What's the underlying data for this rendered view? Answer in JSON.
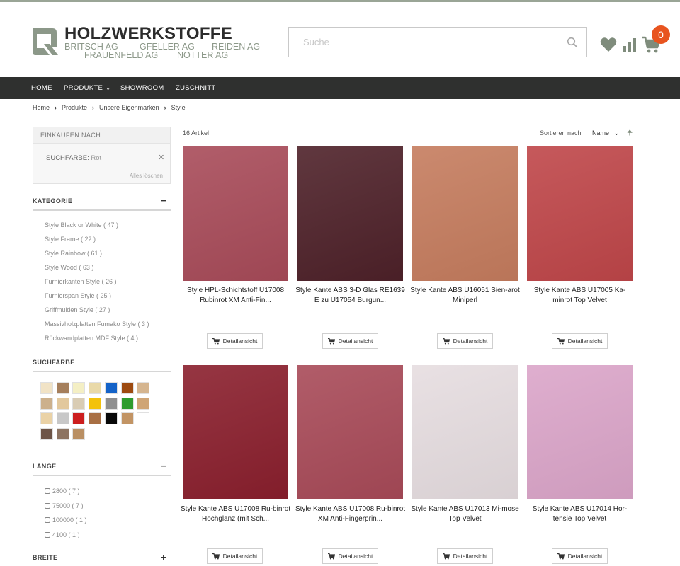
{
  "brand": {
    "title": "HOLZWERKSTOFFE",
    "sub": [
      "BRITSCH AG",
      "GFELLER AG",
      "REIDEN AG",
      "FRAUENFELD AG",
      "NOTTER AG"
    ]
  },
  "search": {
    "placeholder": "Suche"
  },
  "header_icons": [
    "search-icon",
    "heart-icon",
    "bar-chart-icon",
    "cart-icon"
  ],
  "cart": {
    "count": "0"
  },
  "colors": {
    "accent": "#e8541f",
    "nav_bg": "#2f302f",
    "brand_green": "#8c9889"
  },
  "nav": {
    "home": "HOME",
    "produkte": "PRODUKTE",
    "showroom": "SHOWROOM",
    "zuschnitt": "ZUSCHNITT"
  },
  "breadcrumb": [
    "Home",
    "Produkte",
    "Unsere Eigenmarken",
    "Style"
  ],
  "shop_by": {
    "title": "EINKAUFEN NACH",
    "filter_label": "SUCHFARBE:",
    "filter_value": "Rot",
    "clear_all": "Alles löschen"
  },
  "kategorie": {
    "title": "KATEGORIE",
    "items": [
      "Style Black or White ( 47 )",
      "Style Frame ( 22 )",
      "Style Rainbow ( 61 )",
      "Style Wood ( 63 )",
      "Furnierkanten Style ( 26 )",
      "Furnierspan Style ( 25 )",
      "Griffmulden Style ( 27 )",
      "Massivholzplatten Fumako Style ( 3 )",
      "Rückwandplatten MDF Style ( 4 )"
    ]
  },
  "suchfarbe": {
    "title": "SUCHFARBE",
    "swatches": [
      "#f1e3c6",
      "#a57f5c",
      "#f4efc4",
      "#e9d9a8",
      "#1563c8",
      "#9d4a10",
      "#d5b58f",
      "#ccb08c",
      "#e2c89d",
      "#d9ccb4",
      "#f3c20b",
      "#8f8f8f",
      "#2e9b2e",
      "#cfa576",
      "#ead2a6",
      "#c8c8c8",
      "#cc1e1e",
      "#a86f44",
      "#080808",
      "#c29464",
      "#ffffff",
      "#6d5447",
      "#8d7462",
      "#b98f63"
    ]
  },
  "laenge": {
    "title": "LÄNGE",
    "items": [
      "2800 ( 7 )",
      "75000 ( 7 )",
      "100000 ( 1 )",
      "4100 ( 1 )"
    ]
  },
  "breite": {
    "title": "BREITE"
  },
  "toolbar": {
    "count": "16 Artikel",
    "sort_label": "Sortieren nach",
    "sort_value": "Name"
  },
  "products": [
    {
      "name": "Style HPL-Schichtstoff U17008 Rubinrot XM Anti-Fin...",
      "color": "#a84b59",
      "button": "Detailansicht"
    },
    {
      "name": "Style Kante ABS 3-D Glas RE1639 E zu U17054 Burgun...",
      "color": "#4e2129",
      "button": "Detailansicht"
    },
    {
      "name": "Style Kante ABS U16051 Sien-arot Miniperl",
      "color": "#c57c5e",
      "button": "Detailansicht"
    },
    {
      "name": "Style Kante ABS U17005 Ka-minrot Top Velvet",
      "color": "#bf4649",
      "button": "Detailansicht"
    },
    {
      "name": "Style Kante ABS U17008 Ru-binrot Hochglanz (mit Sch...",
      "color": "#8a1f2d",
      "button": "Detailansicht"
    },
    {
      "name": "Style Kante ABS U17008 Ru-binrot XM Anti-Fingerprin...",
      "color": "#a84a58",
      "button": "Detailansicht"
    },
    {
      "name": "Style Kante ABS U17013 Mi-mose Top Velvet",
      "color": "#e6dde0",
      "button": "Detailansicht"
    },
    {
      "name": "Style Kante ABS U17014 Hor-tensie Top Velvet",
      "color": "#dba5c9",
      "button": "Detailansicht"
    }
  ]
}
